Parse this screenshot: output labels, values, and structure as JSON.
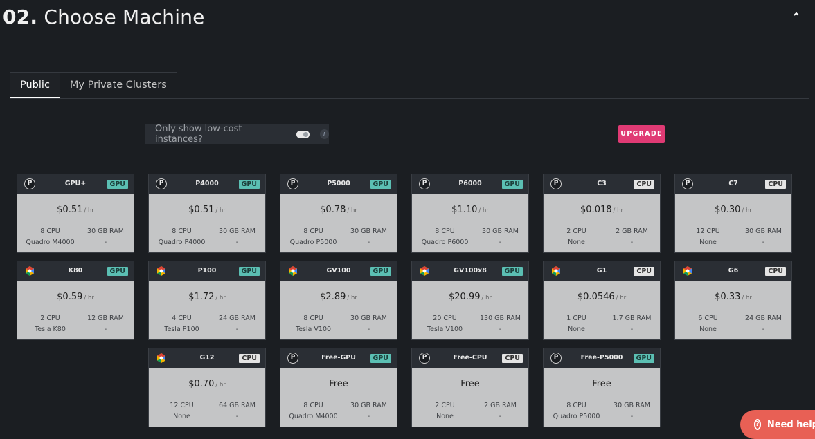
{
  "header": {
    "number": "02.",
    "title": "Choose Machine",
    "collapse_icon": "chevron-up-icon"
  },
  "tabs": [
    {
      "label": "Public",
      "active": true
    },
    {
      "label": "My Private Clusters",
      "active": false
    }
  ],
  "filter": {
    "label": "Only show low-cost instances?",
    "toggle_on": false,
    "info_icon": "i"
  },
  "upgrade_label": "UPGRADE",
  "price_unit": "/ hr",
  "machines": [
    {
      "name": "GPU+",
      "type": "GPU",
      "provider": "paperspace",
      "price": "$0.51",
      "cpu": "8 CPU",
      "ram": "30 GB RAM",
      "gpu": "Quadro M4000",
      "extra": "-"
    },
    {
      "name": "P4000",
      "type": "GPU",
      "provider": "paperspace",
      "price": "$0.51",
      "cpu": "8 CPU",
      "ram": "30 GB RAM",
      "gpu": "Quadro P4000",
      "extra": "-"
    },
    {
      "name": "P5000",
      "type": "GPU",
      "provider": "paperspace",
      "price": "$0.78",
      "cpu": "8 CPU",
      "ram": "30 GB RAM",
      "gpu": "Quadro P5000",
      "extra": "-"
    },
    {
      "name": "P6000",
      "type": "GPU",
      "provider": "paperspace",
      "price": "$1.10",
      "cpu": "8 CPU",
      "ram": "30 GB RAM",
      "gpu": "Quadro P6000",
      "extra": "-"
    },
    {
      "name": "C3",
      "type": "CPU",
      "provider": "paperspace",
      "price": "$0.018",
      "cpu": "2 CPU",
      "ram": "2 GB RAM",
      "gpu": "None",
      "extra": "-"
    },
    {
      "name": "C7",
      "type": "CPU",
      "provider": "paperspace",
      "price": "$0.30",
      "cpu": "12 CPU",
      "ram": "30 GB RAM",
      "gpu": "None",
      "extra": "-"
    },
    {
      "name": "K80",
      "type": "GPU",
      "provider": "gcp",
      "price": "$0.59",
      "cpu": "2 CPU",
      "ram": "12 GB RAM",
      "gpu": "Tesla K80",
      "extra": "-"
    },
    {
      "name": "P100",
      "type": "GPU",
      "provider": "gcp",
      "price": "$1.72",
      "cpu": "4 CPU",
      "ram": "24 GB RAM",
      "gpu": "Tesla P100",
      "extra": "-"
    },
    {
      "name": "GV100",
      "type": "GPU",
      "provider": "gcp",
      "price": "$2.89",
      "cpu": "8 CPU",
      "ram": "30 GB RAM",
      "gpu": "Tesla V100",
      "extra": "-"
    },
    {
      "name": "GV100x8",
      "type": "GPU",
      "provider": "gcp",
      "price": "$20.99",
      "cpu": "20 CPU",
      "ram": "130 GB RAM",
      "gpu": "Tesla V100",
      "extra": "-"
    },
    {
      "name": "G1",
      "type": "CPU",
      "provider": "gcp",
      "price": "$0.0546",
      "cpu": "1 CPU",
      "ram": "1.7 GB RAM",
      "gpu": "None",
      "extra": "-"
    },
    {
      "name": "G6",
      "type": "CPU",
      "provider": "gcp",
      "price": "$0.33",
      "cpu": "6 CPU",
      "ram": "24 GB RAM",
      "gpu": "None",
      "extra": "-"
    },
    {
      "name": "G12",
      "type": "CPU",
      "provider": "gcp",
      "price": "$0.70",
      "cpu": "12 CPU",
      "ram": "64 GB RAM",
      "gpu": "None",
      "extra": "-"
    },
    {
      "name": "Free-GPU",
      "type": "GPU",
      "provider": "paperspace",
      "price": "Free",
      "cpu": "8 CPU",
      "ram": "30 GB RAM",
      "gpu": "Quadro M4000",
      "extra": "-"
    },
    {
      "name": "Free-CPU",
      "type": "CPU",
      "provider": "paperspace",
      "price": "Free",
      "cpu": "2 CPU",
      "ram": "2 GB RAM",
      "gpu": "None",
      "extra": "-"
    },
    {
      "name": "Free-P5000",
      "type": "GPU",
      "provider": "paperspace",
      "price": "Free",
      "cpu": "8 CPU",
      "ram": "30 GB RAM",
      "gpu": "Quadro P5000",
      "extra": "-"
    }
  ],
  "help": {
    "label": "Need help?",
    "icon": "question-icon"
  },
  "colors": {
    "gpu_badge": "#5bbfb3",
    "cpu_badge": "#e4e4e4",
    "upgrade": "#e03a74",
    "help": "#e86055",
    "background": "#1b1e22"
  }
}
